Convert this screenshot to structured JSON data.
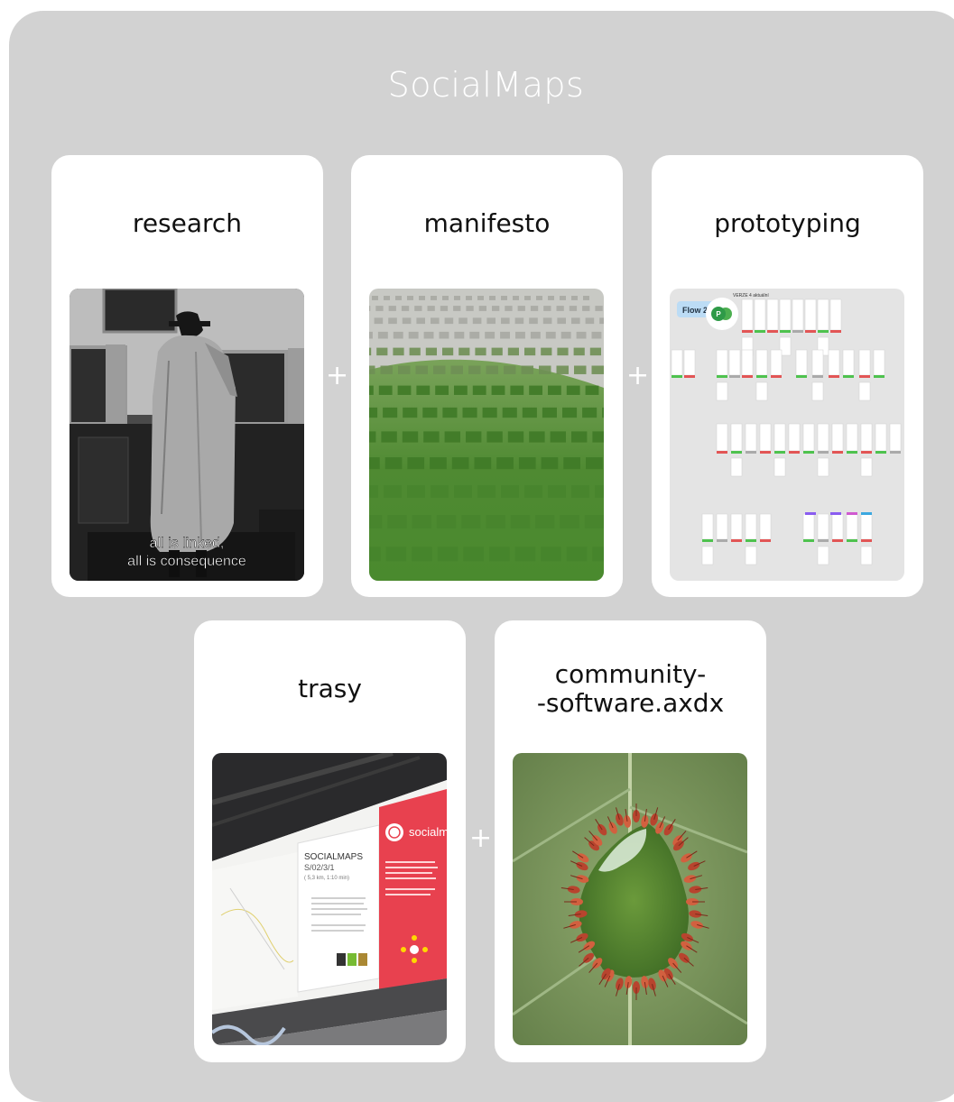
{
  "title": "SocialMaps",
  "cards": [
    {
      "label": "research",
      "caption_line1": "all is linked,",
      "caption_line2": "all is consequence"
    },
    {
      "label": "manifesto"
    },
    {
      "label": "prototyping",
      "flow_label": "Flow 2",
      "avatar_letter": "P",
      "header_text": "VERZE 4  aktuální"
    },
    {
      "label": "trasy",
      "poster_title": "SOCIALMAPS",
      "poster_sub": "S/02/3/1",
      "poster_dist": "( 5,3 km, 1:10 min)",
      "panel_text": "socialm"
    },
    {
      "label_line1": "community-",
      "label_line2": "-software.axdx"
    }
  ],
  "connectors": [
    "+",
    "+",
    "+"
  ]
}
